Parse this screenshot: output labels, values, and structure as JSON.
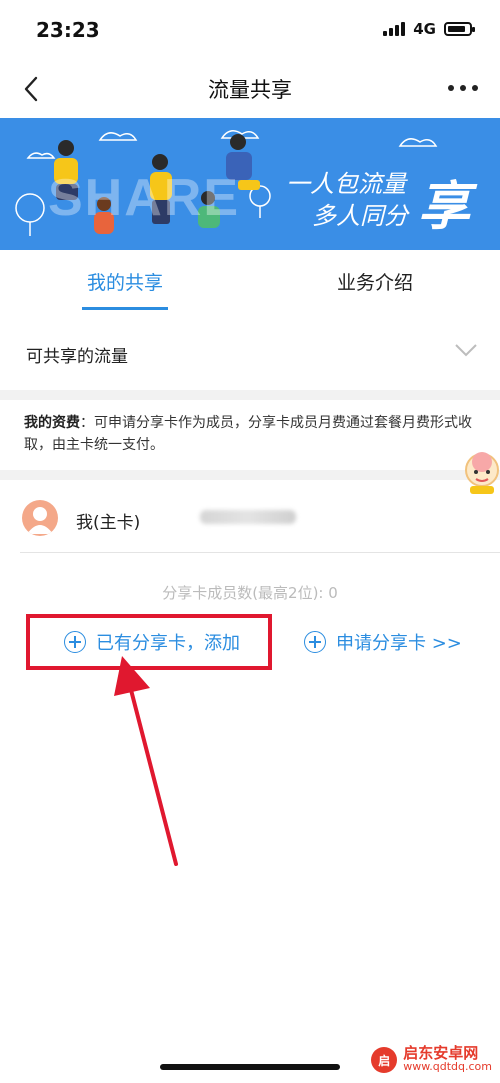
{
  "status": {
    "time": "23:23",
    "network": "4G"
  },
  "nav": {
    "title": "流量共享"
  },
  "banner": {
    "bg_text": "SHARE",
    "slogan_line1": "一人包流量",
    "slogan_line2": "多人同分",
    "slogan_big": "享"
  },
  "tabs": [
    {
      "label": "我的共享"
    },
    {
      "label": "业务介绍"
    }
  ],
  "share": {
    "label": "可共享的流量"
  },
  "fee": {
    "title": "我的资费",
    "text": "：可申请分享卡作为成员，分享卡成员月费通过套餐月费形式收取，由主卡统一支付。"
  },
  "member": {
    "label": "我(主卡)"
  },
  "count": {
    "text": "分享卡成员数(最高2位): 0"
  },
  "actions": {
    "add_label": "已有分享卡，添加",
    "apply_label": "申请分享卡 >>"
  },
  "watermark": {
    "logo": "启",
    "name": "启东安卓网",
    "url": "www.qdtdq.com"
  },
  "colors": {
    "accent": "#2b8de0",
    "banner": "#3a8ee6",
    "highlight": "#e0182f"
  }
}
